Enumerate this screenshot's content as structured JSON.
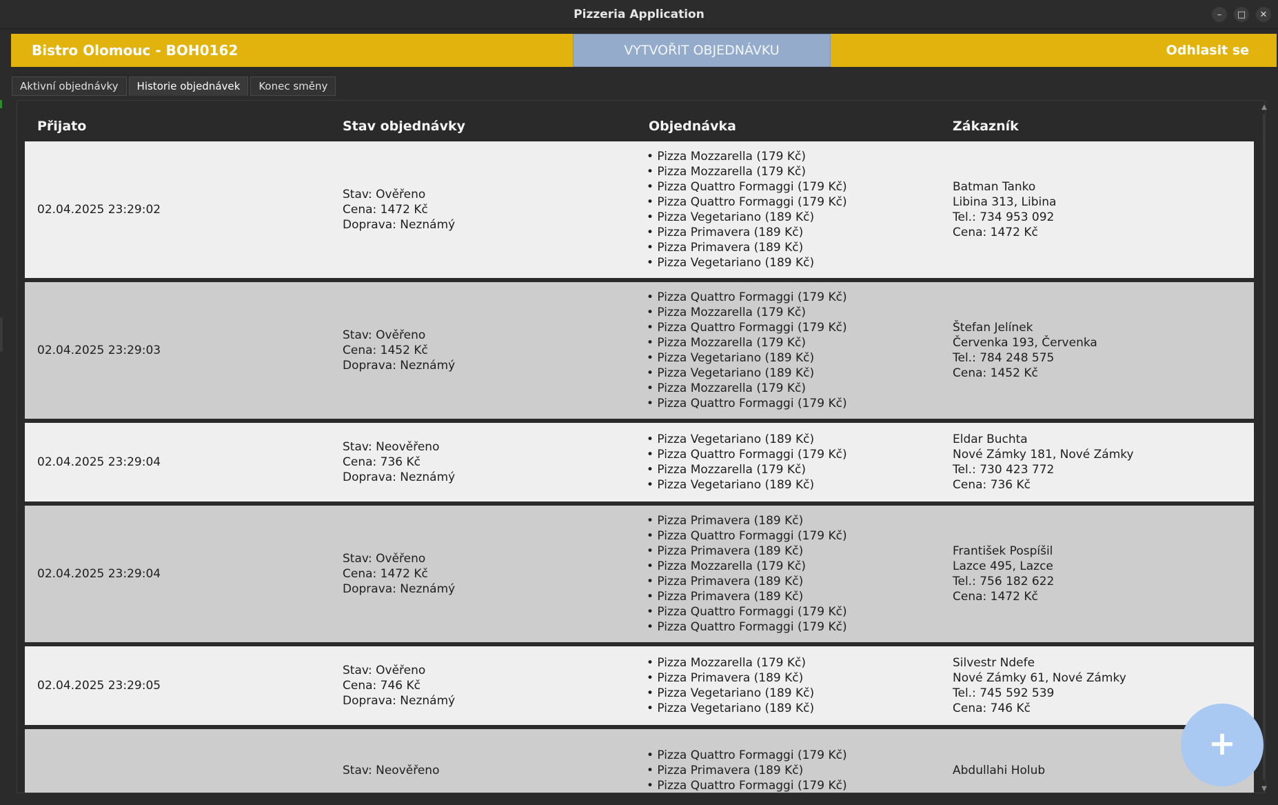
{
  "window": {
    "title": "Pizzeria Application"
  },
  "appbar": {
    "bistro": "Bistro Olomouc - BOH0162",
    "create_button": "VYTVOŘIT OBJEDNÁVKU",
    "logout": "Odhlasit se",
    "color": "#e2b30c"
  },
  "tabs": [
    {
      "label": "Aktivní objednávky"
    },
    {
      "label": "Historie objednávek",
      "active": true
    },
    {
      "label": "Konec směny"
    }
  ],
  "table": {
    "headers": [
      "Přijato",
      "Stav objednávky",
      "Objednávka",
      "Zákazník"
    ],
    "rows": [
      {
        "received": "02.04.2025 23:29:02",
        "status": [
          "Stav: Ověřeno",
          "Cena: 1472 Kč",
          "Doprava: Neznámý"
        ],
        "items": [
          "• Pizza Mozzarella (179 Kč)",
          "• Pizza Mozzarella (179 Kč)",
          "• Pizza Quattro Formaggi (179 Kč)",
          "• Pizza Quattro Formaggi (179 Kč)",
          "• Pizza Vegetariano (189 Kč)",
          "• Pizza Primavera (189 Kč)",
          "• Pizza Primavera (189 Kč)",
          "• Pizza Vegetariano (189 Kč)"
        ],
        "customer": [
          "Batman  Tanko",
          "Libina 313, Libina",
          "Tel.: 734 953 092",
          "Cena: 1472 Kč"
        ]
      },
      {
        "received": "02.04.2025 23:29:03",
        "status": [
          "Stav: Ověřeno",
          "Cena: 1452 Kč",
          "Doprava: Neznámý"
        ],
        "items": [
          "• Pizza Quattro Formaggi (179 Kč)",
          "• Pizza Mozzarella (179 Kč)",
          "• Pizza Quattro Formaggi (179 Kč)",
          "• Pizza Mozzarella (179 Kč)",
          "• Pizza Vegetariano (189 Kč)",
          "• Pizza Vegetariano (189 Kč)",
          "• Pizza Mozzarella (179 Kč)",
          "• Pizza Quattro Formaggi (179 Kč)"
        ],
        "customer": [
          "Štefan  Jelínek",
          "Červenka 193, Červenka",
          "Tel.: 784 248 575",
          "Cena: 1452 Kč"
        ]
      },
      {
        "received": "02.04.2025 23:29:04",
        "status": [
          "Stav: Neověřeno",
          "Cena: 736 Kč",
          "Doprava: Neznámý"
        ],
        "items": [
          "• Pizza Vegetariano (189 Kč)",
          "• Pizza Quattro Formaggi (179 Kč)",
          "• Pizza Mozzarella (179 Kč)",
          "• Pizza Vegetariano (189 Kč)"
        ],
        "customer": [
          "Eldar  Buchta",
          "Nové Zámky 181, Nové Zámky",
          "Tel.: 730 423 772",
          "Cena: 736 Kč"
        ]
      },
      {
        "received": "02.04.2025 23:29:04",
        "status": [
          "Stav: Ověřeno",
          "Cena: 1472 Kč",
          "Doprava: Neznámý"
        ],
        "items": [
          "• Pizza Primavera (189 Kč)",
          "• Pizza Quattro Formaggi (179 Kč)",
          "• Pizza Primavera (189 Kč)",
          "• Pizza Mozzarella (179 Kč)",
          "• Pizza Primavera (189 Kč)",
          "• Pizza Primavera (189 Kč)",
          "• Pizza Quattro Formaggi (179 Kč)",
          "• Pizza Quattro Formaggi (179 Kč)"
        ],
        "customer": [
          "František  Pospíšil",
          "Lazce 495, Lazce",
          "Tel.: 756 182 622",
          "Cena: 1472 Kč"
        ]
      },
      {
        "received": "02.04.2025 23:29:05",
        "status": [
          "Stav: Ověřeno",
          "Cena: 746 Kč",
          "Doprava: Neznámý"
        ],
        "items": [
          "• Pizza Mozzarella (179 Kč)",
          "• Pizza Primavera (189 Kč)",
          "• Pizza Vegetariano (189 Kč)",
          "• Pizza Vegetariano (189 Kč)"
        ],
        "customer": [
          "Silvestr  Ndefe",
          "Nové Zámky 61, Nové Zámky",
          "Tel.: 745 592 539",
          "Cena: 746 Kč"
        ]
      },
      {
        "received": "",
        "status": [
          "Stav: Neověřeno"
        ],
        "items": [
          "• Pizza Quattro Formaggi (179 Kč)",
          "• Pizza Primavera (189 Kč)",
          "• Pizza Quattro Formaggi (179 Kč)"
        ],
        "customer": [
          "Abdullahi  Holub"
        ]
      }
    ]
  },
  "fab": {
    "label": "+",
    "icon": "plus-icon"
  }
}
